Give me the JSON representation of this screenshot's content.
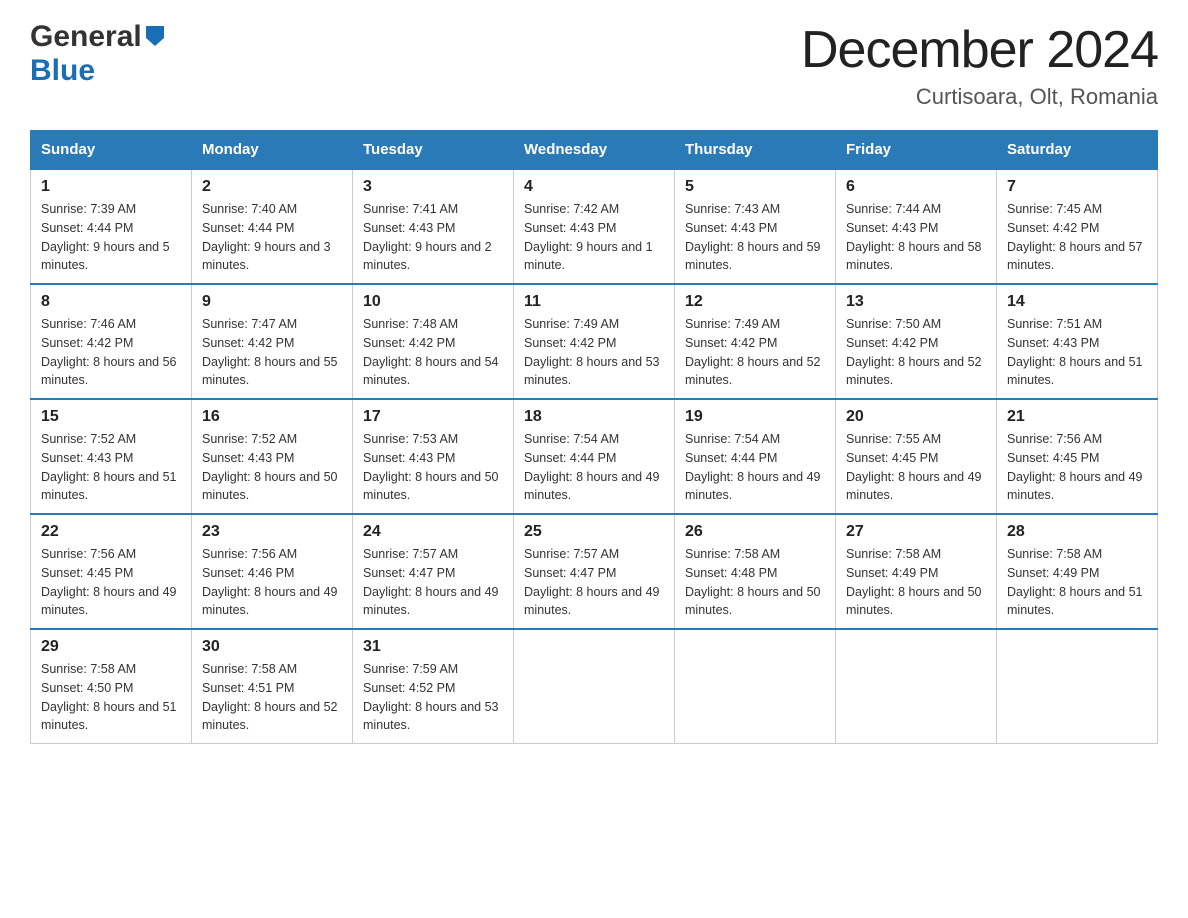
{
  "header": {
    "logo_general": "General",
    "logo_blue": "Blue",
    "month_title": "December 2024",
    "location": "Curtisoara, Olt, Romania"
  },
  "calendar": {
    "days_of_week": [
      "Sunday",
      "Monday",
      "Tuesday",
      "Wednesday",
      "Thursday",
      "Friday",
      "Saturday"
    ],
    "weeks": [
      [
        {
          "day": "1",
          "sunrise": "7:39 AM",
          "sunset": "4:44 PM",
          "daylight": "9 hours and 5 minutes."
        },
        {
          "day": "2",
          "sunrise": "7:40 AM",
          "sunset": "4:44 PM",
          "daylight": "9 hours and 3 minutes."
        },
        {
          "day": "3",
          "sunrise": "7:41 AM",
          "sunset": "4:43 PM",
          "daylight": "9 hours and 2 minutes."
        },
        {
          "day": "4",
          "sunrise": "7:42 AM",
          "sunset": "4:43 PM",
          "daylight": "9 hours and 1 minute."
        },
        {
          "day": "5",
          "sunrise": "7:43 AM",
          "sunset": "4:43 PM",
          "daylight": "8 hours and 59 minutes."
        },
        {
          "day": "6",
          "sunrise": "7:44 AM",
          "sunset": "4:43 PM",
          "daylight": "8 hours and 58 minutes."
        },
        {
          "day": "7",
          "sunrise": "7:45 AM",
          "sunset": "4:42 PM",
          "daylight": "8 hours and 57 minutes."
        }
      ],
      [
        {
          "day": "8",
          "sunrise": "7:46 AM",
          "sunset": "4:42 PM",
          "daylight": "8 hours and 56 minutes."
        },
        {
          "day": "9",
          "sunrise": "7:47 AM",
          "sunset": "4:42 PM",
          "daylight": "8 hours and 55 minutes."
        },
        {
          "day": "10",
          "sunrise": "7:48 AM",
          "sunset": "4:42 PM",
          "daylight": "8 hours and 54 minutes."
        },
        {
          "day": "11",
          "sunrise": "7:49 AM",
          "sunset": "4:42 PM",
          "daylight": "8 hours and 53 minutes."
        },
        {
          "day": "12",
          "sunrise": "7:49 AM",
          "sunset": "4:42 PM",
          "daylight": "8 hours and 52 minutes."
        },
        {
          "day": "13",
          "sunrise": "7:50 AM",
          "sunset": "4:42 PM",
          "daylight": "8 hours and 52 minutes."
        },
        {
          "day": "14",
          "sunrise": "7:51 AM",
          "sunset": "4:43 PM",
          "daylight": "8 hours and 51 minutes."
        }
      ],
      [
        {
          "day": "15",
          "sunrise": "7:52 AM",
          "sunset": "4:43 PM",
          "daylight": "8 hours and 51 minutes."
        },
        {
          "day": "16",
          "sunrise": "7:52 AM",
          "sunset": "4:43 PM",
          "daylight": "8 hours and 50 minutes."
        },
        {
          "day": "17",
          "sunrise": "7:53 AM",
          "sunset": "4:43 PM",
          "daylight": "8 hours and 50 minutes."
        },
        {
          "day": "18",
          "sunrise": "7:54 AM",
          "sunset": "4:44 PM",
          "daylight": "8 hours and 49 minutes."
        },
        {
          "day": "19",
          "sunrise": "7:54 AM",
          "sunset": "4:44 PM",
          "daylight": "8 hours and 49 minutes."
        },
        {
          "day": "20",
          "sunrise": "7:55 AM",
          "sunset": "4:45 PM",
          "daylight": "8 hours and 49 minutes."
        },
        {
          "day": "21",
          "sunrise": "7:56 AM",
          "sunset": "4:45 PM",
          "daylight": "8 hours and 49 minutes."
        }
      ],
      [
        {
          "day": "22",
          "sunrise": "7:56 AM",
          "sunset": "4:45 PM",
          "daylight": "8 hours and 49 minutes."
        },
        {
          "day": "23",
          "sunrise": "7:56 AM",
          "sunset": "4:46 PM",
          "daylight": "8 hours and 49 minutes."
        },
        {
          "day": "24",
          "sunrise": "7:57 AM",
          "sunset": "4:47 PM",
          "daylight": "8 hours and 49 minutes."
        },
        {
          "day": "25",
          "sunrise": "7:57 AM",
          "sunset": "4:47 PM",
          "daylight": "8 hours and 49 minutes."
        },
        {
          "day": "26",
          "sunrise": "7:58 AM",
          "sunset": "4:48 PM",
          "daylight": "8 hours and 50 minutes."
        },
        {
          "day": "27",
          "sunrise": "7:58 AM",
          "sunset": "4:49 PM",
          "daylight": "8 hours and 50 minutes."
        },
        {
          "day": "28",
          "sunrise": "7:58 AM",
          "sunset": "4:49 PM",
          "daylight": "8 hours and 51 minutes."
        }
      ],
      [
        {
          "day": "29",
          "sunrise": "7:58 AM",
          "sunset": "4:50 PM",
          "daylight": "8 hours and 51 minutes."
        },
        {
          "day": "30",
          "sunrise": "7:58 AM",
          "sunset": "4:51 PM",
          "daylight": "8 hours and 52 minutes."
        },
        {
          "day": "31",
          "sunrise": "7:59 AM",
          "sunset": "4:52 PM",
          "daylight": "8 hours and 53 minutes."
        },
        null,
        null,
        null,
        null
      ]
    ]
  }
}
